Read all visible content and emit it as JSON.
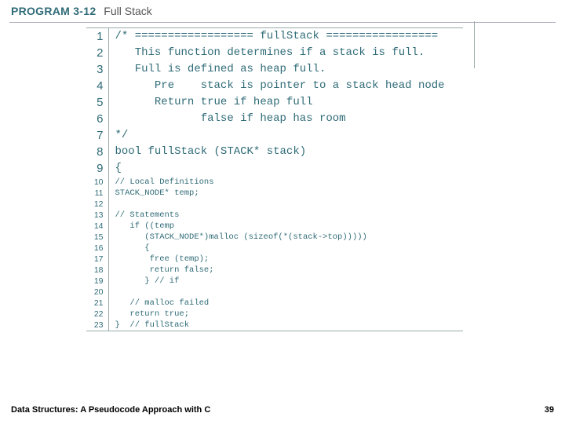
{
  "header": {
    "label": "PROGRAM 3-12",
    "title": "Full Stack"
  },
  "code": {
    "lines": [
      {
        "n": 1,
        "big": true,
        "t": "/* ================== fullStack ================="
      },
      {
        "n": 2,
        "big": true,
        "t": "   This function determines if a stack is full."
      },
      {
        "n": 3,
        "big": true,
        "t": "   Full is defined as heap full."
      },
      {
        "n": 4,
        "big": true,
        "t": "      Pre    stack is pointer to a stack head node"
      },
      {
        "n": 5,
        "big": true,
        "t": "      Return true if heap full"
      },
      {
        "n": 6,
        "big": true,
        "t": "             false if heap has room"
      },
      {
        "n": 7,
        "big": true,
        "t": "*/"
      },
      {
        "n": 8,
        "big": true,
        "t": "bool fullStack (STACK* stack)"
      },
      {
        "n": 9,
        "big": true,
        "t": "{"
      },
      {
        "n": 10,
        "big": false,
        "t": "// Local Definitions"
      },
      {
        "n": 11,
        "big": false,
        "t": "STACK_NODE* temp;"
      },
      {
        "n": 12,
        "big": false,
        "t": ""
      },
      {
        "n": 13,
        "big": false,
        "t": "// Statements"
      },
      {
        "n": 14,
        "big": false,
        "t": "   if ((temp"
      },
      {
        "n": 15,
        "big": false,
        "t": "      (STACK_NODE*)malloc (sizeof(*(stack->top)))))"
      },
      {
        "n": 16,
        "big": false,
        "t": "      {"
      },
      {
        "n": 17,
        "big": false,
        "t": "       free (temp);"
      },
      {
        "n": 18,
        "big": false,
        "t": "       return false;"
      },
      {
        "n": 19,
        "big": false,
        "t": "      } // if"
      },
      {
        "n": 20,
        "big": false,
        "t": ""
      },
      {
        "n": 21,
        "big": false,
        "t": "   // malloc failed"
      },
      {
        "n": 22,
        "big": false,
        "t": "   return true;"
      },
      {
        "n": 23,
        "big": false,
        "t": "}  // fullStack"
      }
    ]
  },
  "footer": {
    "book": "Data Structures: A Pseudocode Approach with C",
    "page": "39"
  }
}
